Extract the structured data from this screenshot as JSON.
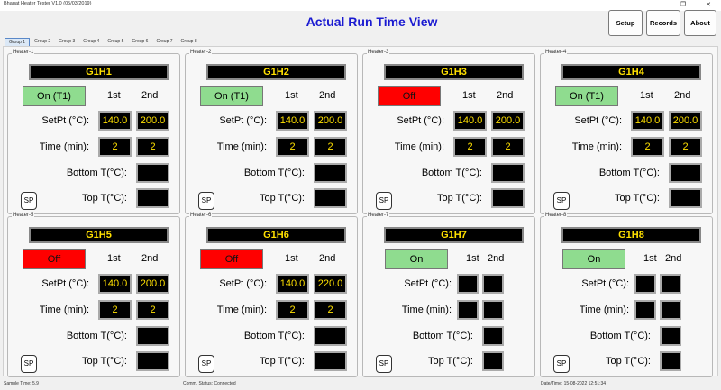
{
  "window": {
    "title": "Bhagat Heater Tester V1.0 (05/03/2019)",
    "controls": [
      "–",
      "❐",
      "✕"
    ]
  },
  "header": {
    "title": "Actual Run Time View",
    "buttons": {
      "setup": "Setup",
      "records": "Records",
      "about": "About"
    }
  },
  "tabs": [
    "Group 1",
    "Group 2",
    "Group 3",
    "Group 4",
    "Group 5",
    "Group 6",
    "Group 7",
    "Group 8"
  ],
  "labels": {
    "first": "1st",
    "second": "2nd",
    "setpt": "SetPt (°C):",
    "setpt_alt": "SetPt (°C):",
    "time": "Time (min):",
    "bottom": "Bottom T(°C):",
    "top": "Top T(°C):",
    "sp": "SP"
  },
  "heaters": [
    {
      "legend": "Heater-1",
      "name": "G1H1",
      "status": "On (T1)",
      "state": "on",
      "setpt1": "140.0",
      "setpt2": "200.0",
      "time1": "2",
      "time2": "2",
      "bottom": "",
      "top": ""
    },
    {
      "legend": "Heater-2",
      "name": "G1H2",
      "status": "On (T1)",
      "state": "on",
      "setpt1": "140.0",
      "setpt2": "200.0",
      "time1": "2",
      "time2": "2",
      "bottom": "",
      "top": ""
    },
    {
      "legend": "Heater-3",
      "name": "G1H3",
      "status": "Off",
      "state": "off",
      "setpt1": "140.0",
      "setpt2": "200.0",
      "time1": "2",
      "time2": "2",
      "bottom": "",
      "top": ""
    },
    {
      "legend": "Heater-4",
      "name": "G1H4",
      "status": "On (T1)",
      "state": "on",
      "setpt1": "140.0",
      "setpt2": "200.0",
      "time1": "2",
      "time2": "2",
      "bottom": "",
      "top": ""
    },
    {
      "legend": "Heater-5",
      "name": "G1H5",
      "status": "Off",
      "state": "off",
      "setpt1": "140.0",
      "setpt2": "200.0",
      "time1": "2",
      "time2": "2",
      "bottom": "",
      "top": ""
    },
    {
      "legend": "Heater-6",
      "name": "G1H6",
      "status": "Off",
      "state": "off",
      "setpt1": "140.0",
      "setpt2": "220.0",
      "time1": "2",
      "time2": "2",
      "bottom": "",
      "top": ""
    },
    {
      "legend": "Heater-7",
      "name": "G1H7",
      "status": "On",
      "state": "on",
      "setpt1": "",
      "setpt2": "",
      "time1": "",
      "time2": "",
      "bottom": "",
      "top": ""
    },
    {
      "legend": "Heater-8",
      "name": "G1H8",
      "status": "On",
      "state": "on",
      "setpt1": "",
      "setpt2": "",
      "time1": "",
      "time2": "",
      "bottom": "",
      "top": ""
    }
  ],
  "statusbar": {
    "sample_time": "Sample Time: 5.9",
    "comm_status": "Comm. Status: Connected",
    "datetime": "Date/Time: 15-08-2022 12:51:34"
  },
  "colors": {
    "title": "#1a1ad1",
    "on": "#8fdc8f",
    "off": "#ff0000",
    "value": "#ffe000",
    "value_bg": "#000000"
  }
}
